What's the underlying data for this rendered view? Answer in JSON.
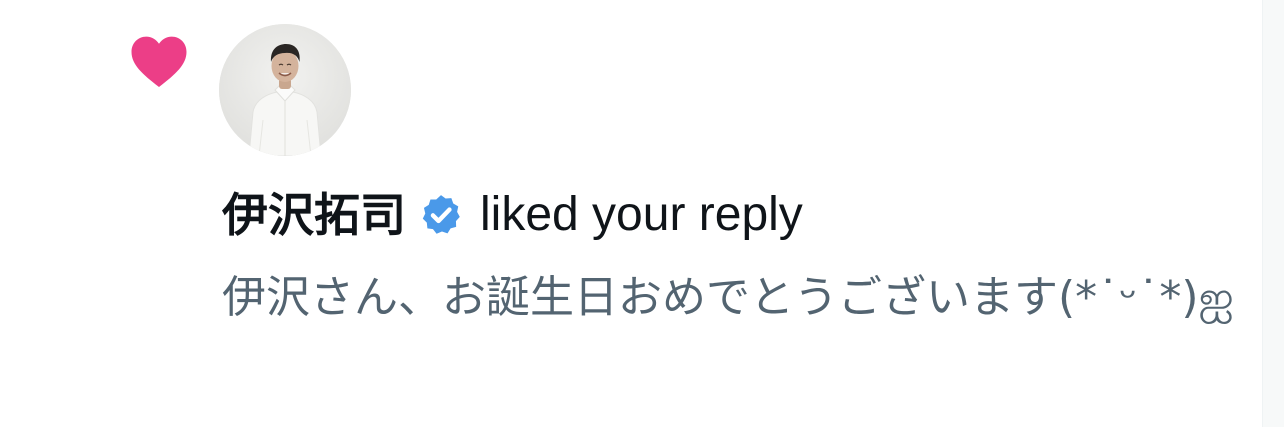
{
  "notification": {
    "type_icon": "heart-icon",
    "type_icon_color": "#ec3e87",
    "user": {
      "name": "伊沢拓司",
      "verified": true,
      "verified_icon": "verified-badge-icon",
      "verified_color": "#4a99e9"
    },
    "action_text": "liked your reply",
    "reply_text": "伊沢さん、お誕生日おめでとうございます(*˙ᵕ˙*)ஐ"
  },
  "colors": {
    "text_primary": "#0f1419",
    "text_secondary": "#536471",
    "background": "#ffffff"
  }
}
